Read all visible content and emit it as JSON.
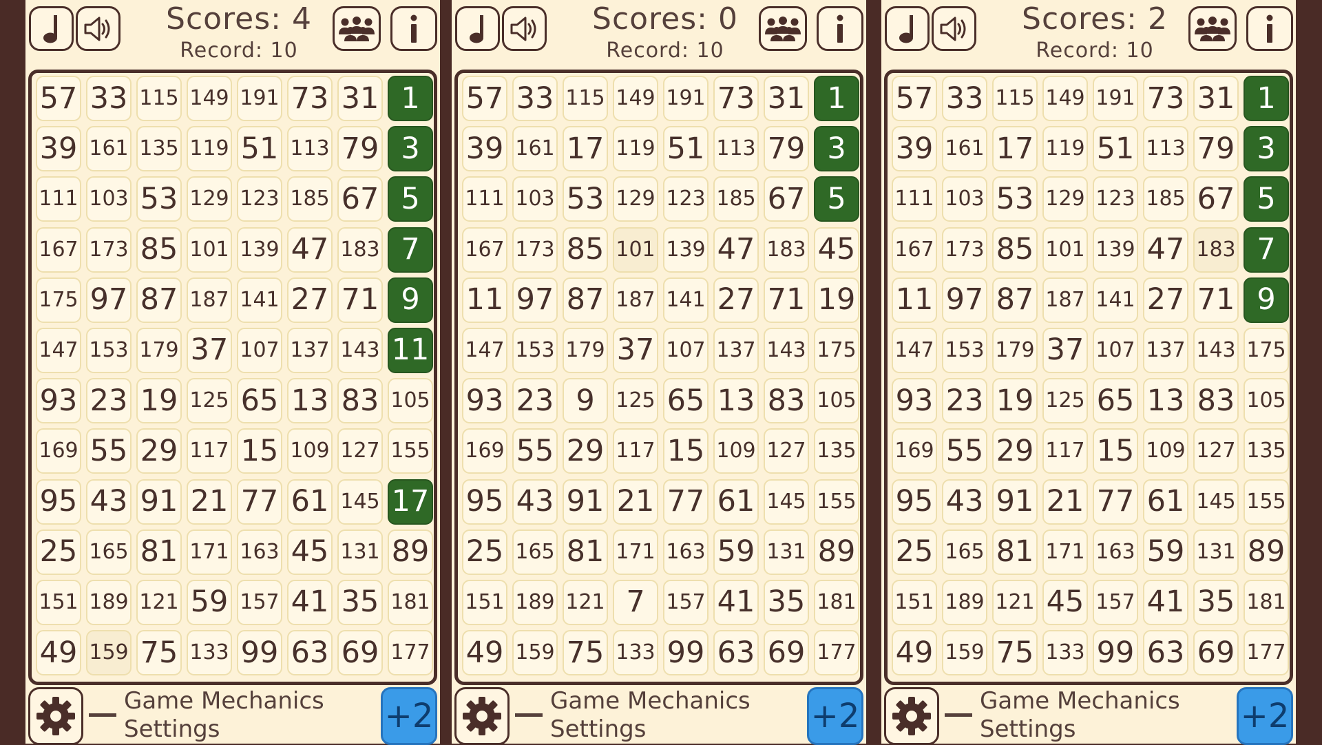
{
  "panels": [
    {
      "scores_text": "Scores: 4",
      "record_text": "Record: 10",
      "rows": [
        [
          "57",
          "33",
          "115",
          "149",
          "191",
          "73",
          "31",
          "1"
        ],
        [
          "39",
          "161",
          "135",
          "119",
          "51",
          "113",
          "79",
          "3"
        ],
        [
          "111",
          "103",
          "53",
          "129",
          "123",
          "185",
          "67",
          "5"
        ],
        [
          "167",
          "173",
          "85",
          "101",
          "139",
          "47",
          "183",
          "7"
        ],
        [
          "175",
          "97",
          "87",
          "187",
          "141",
          "27",
          "71",
          "9"
        ],
        [
          "147",
          "153",
          "179",
          "37",
          "107",
          "137",
          "143",
          "11"
        ],
        [
          "93",
          "23",
          "19",
          "125",
          "65",
          "13",
          "83",
          "105"
        ],
        [
          "169",
          "55",
          "29",
          "117",
          "15",
          "109",
          "127",
          "155"
        ],
        [
          "95",
          "43",
          "91",
          "21",
          "77",
          "61",
          "145",
          "17"
        ],
        [
          "25",
          "165",
          "81",
          "171",
          "163",
          "45",
          "131",
          "89"
        ],
        [
          "151",
          "189",
          "121",
          "59",
          "157",
          "41",
          "35",
          "181"
        ],
        [
          "49",
          "159",
          "75",
          "133",
          "99",
          "63",
          "69",
          "177"
        ]
      ],
      "highlighted": [
        [
          0,
          7
        ],
        [
          1,
          7
        ],
        [
          2,
          7
        ],
        [
          3,
          7
        ],
        [
          4,
          7
        ],
        [
          5,
          7
        ],
        [
          8,
          7
        ]
      ],
      "dimmed": [
        [
          11,
          1
        ]
      ],
      "settings_text": "Game Mechanics\nSettings",
      "plus_label": "+2"
    },
    {
      "scores_text": "Scores: 0",
      "record_text": "Record: 10",
      "rows": [
        [
          "57",
          "33",
          "115",
          "149",
          "191",
          "73",
          "31",
          "1"
        ],
        [
          "39",
          "161",
          "17",
          "119",
          "51",
          "113",
          "79",
          "3"
        ],
        [
          "111",
          "103",
          "53",
          "129",
          "123",
          "185",
          "67",
          "5"
        ],
        [
          "167",
          "173",
          "85",
          "101",
          "139",
          "47",
          "183",
          "45"
        ],
        [
          "11",
          "97",
          "87",
          "187",
          "141",
          "27",
          "71",
          "19"
        ],
        [
          "147",
          "153",
          "179",
          "37",
          "107",
          "137",
          "143",
          "175"
        ],
        [
          "93",
          "23",
          "9",
          "125",
          "65",
          "13",
          "83",
          "105"
        ],
        [
          "169",
          "55",
          "29",
          "117",
          "15",
          "109",
          "127",
          "135"
        ],
        [
          "95",
          "43",
          "91",
          "21",
          "77",
          "61",
          "145",
          "155"
        ],
        [
          "25",
          "165",
          "81",
          "171",
          "163",
          "59",
          "131",
          "89"
        ],
        [
          "151",
          "189",
          "121",
          "7",
          "157",
          "41",
          "35",
          "181"
        ],
        [
          "49",
          "159",
          "75",
          "133",
          "99",
          "63",
          "69",
          "177"
        ]
      ],
      "highlighted": [
        [
          0,
          7
        ],
        [
          1,
          7
        ],
        [
          2,
          7
        ]
      ],
      "dimmed": [
        [
          3,
          3
        ]
      ],
      "settings_text": "Game Mechanics\nSettings",
      "plus_label": "+2"
    },
    {
      "scores_text": "Scores: 2",
      "record_text": "Record: 10",
      "rows": [
        [
          "57",
          "33",
          "115",
          "149",
          "191",
          "73",
          "31",
          "1"
        ],
        [
          "39",
          "161",
          "17",
          "119",
          "51",
          "113",
          "79",
          "3"
        ],
        [
          "111",
          "103",
          "53",
          "129",
          "123",
          "185",
          "67",
          "5"
        ],
        [
          "167",
          "173",
          "85",
          "101",
          "139",
          "47",
          "183",
          "7"
        ],
        [
          "11",
          "97",
          "87",
          "187",
          "141",
          "27",
          "71",
          "9"
        ],
        [
          "147",
          "153",
          "179",
          "37",
          "107",
          "137",
          "143",
          "175"
        ],
        [
          "93",
          "23",
          "19",
          "125",
          "65",
          "13",
          "83",
          "105"
        ],
        [
          "169",
          "55",
          "29",
          "117",
          "15",
          "109",
          "127",
          "135"
        ],
        [
          "95",
          "43",
          "91",
          "21",
          "77",
          "61",
          "145",
          "155"
        ],
        [
          "25",
          "165",
          "81",
          "171",
          "163",
          "59",
          "131",
          "89"
        ],
        [
          "151",
          "189",
          "121",
          "45",
          "157",
          "41",
          "35",
          "181"
        ],
        [
          "49",
          "159",
          "75",
          "133",
          "99",
          "63",
          "69",
          "177"
        ]
      ],
      "highlighted": [
        [
          0,
          7
        ],
        [
          1,
          7
        ],
        [
          2,
          7
        ],
        [
          3,
          7
        ],
        [
          4,
          7
        ]
      ],
      "dimmed": [
        [
          3,
          6
        ]
      ],
      "settings_text": "Game Mechanics\nSettings",
      "plus_label": "+2"
    }
  ],
  "icons": {
    "music": "music-note-icon",
    "sound": "speaker-icon",
    "players": "group-icon",
    "info": "info-icon",
    "settings": "gear-icon"
  },
  "colors": {
    "background": "#fdf2d8",
    "frame": "#4a2e29",
    "highlight": "#2f6926",
    "plus_button": "#3a9be8"
  }
}
